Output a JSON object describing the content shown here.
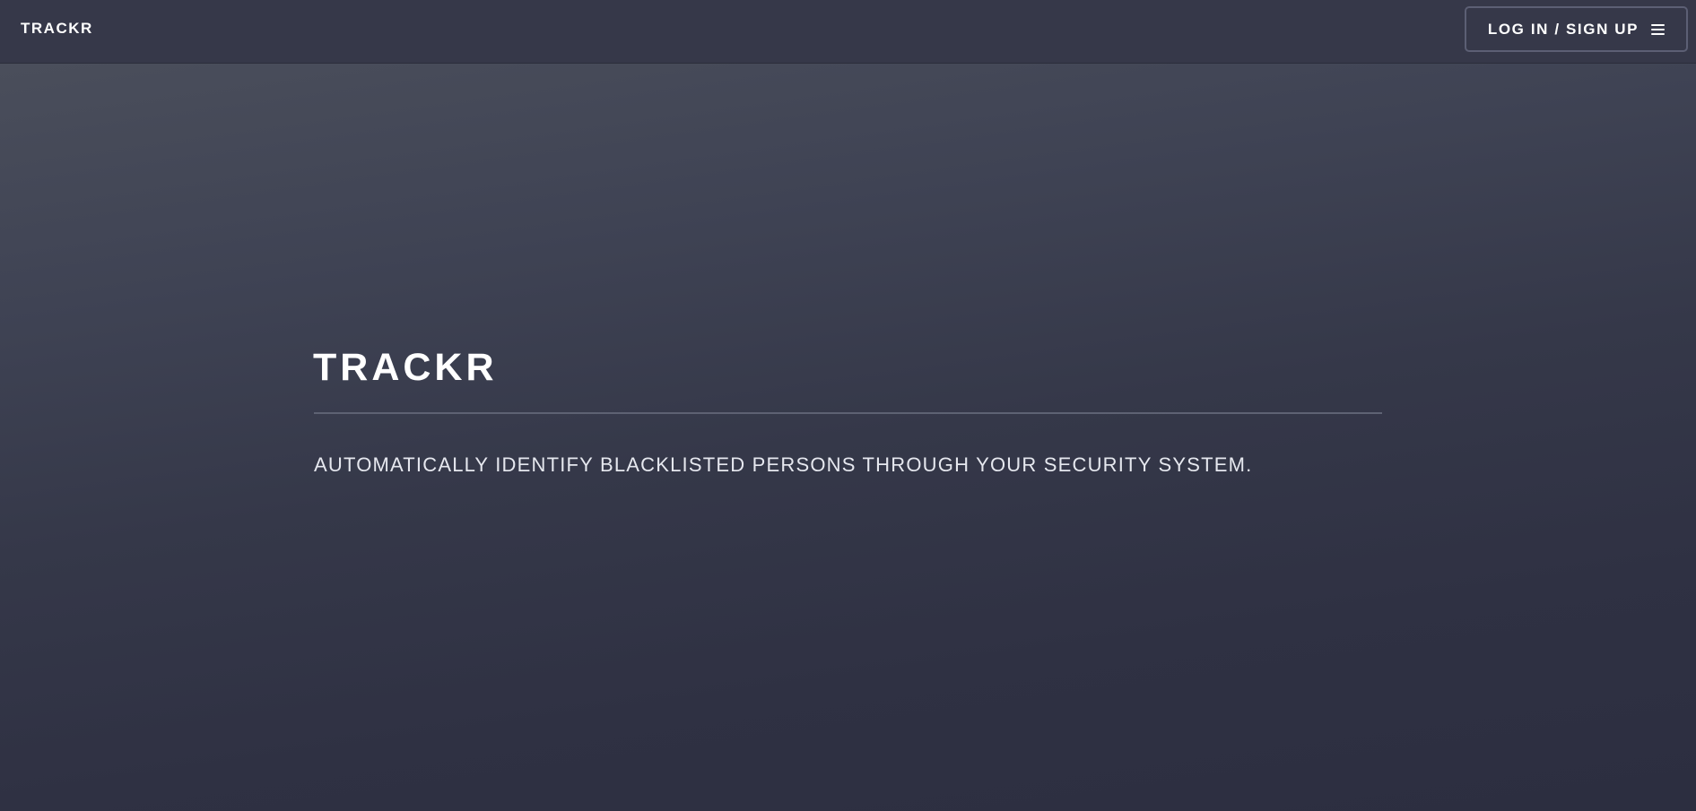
{
  "navbar": {
    "brand": "TRACKR",
    "login_label": "LOG IN / SIGN UP",
    "menu_icon": "hamburger-menu-icon"
  },
  "hero": {
    "title": "TRACKR",
    "subtitle": "AUTOMATICALLY IDENTIFY BLACKLISTED PERSONS THROUGH YOUR SECURITY SYSTEM."
  },
  "colors": {
    "navbar_bg": "#363849",
    "hero_gradient_top": "#4a4e5b",
    "hero_gradient_bottom": "#2c2e40",
    "text": "#ffffff",
    "button_border": "#5c5f74"
  }
}
